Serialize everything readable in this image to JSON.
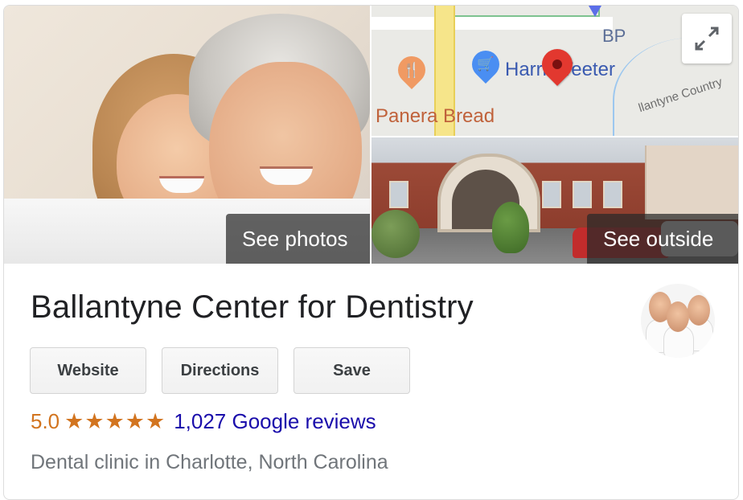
{
  "hero": {
    "see_photos": "See photos",
    "see_outside": "See outside"
  },
  "map": {
    "labels": {
      "bp": "BP",
      "panera": "Panera Bread",
      "harris_teeter": "Harris Teeter",
      "country": "llantyne Country"
    },
    "icons": {
      "food": "restaurant-pin-icon",
      "cart": "shopping-pin-icon",
      "location": "location-pin-icon",
      "expand": "expand-icon"
    },
    "colors": {
      "food_pin": "#f09a63",
      "cart_pin": "#4a8ef2",
      "location_pin": "#e2382f"
    }
  },
  "business": {
    "name": "Ballantyne Center for Dentistry",
    "category": "Dental clinic in Charlotte, North Carolina"
  },
  "actions": {
    "website": "Website",
    "directions": "Directions",
    "save": "Save"
  },
  "rating": {
    "value": "5.0",
    "stars_display": "★★★★★",
    "stars": 5,
    "reviews_link": "1,027 Google reviews",
    "color": "#d2741f",
    "link_color": "#1a0dab"
  }
}
